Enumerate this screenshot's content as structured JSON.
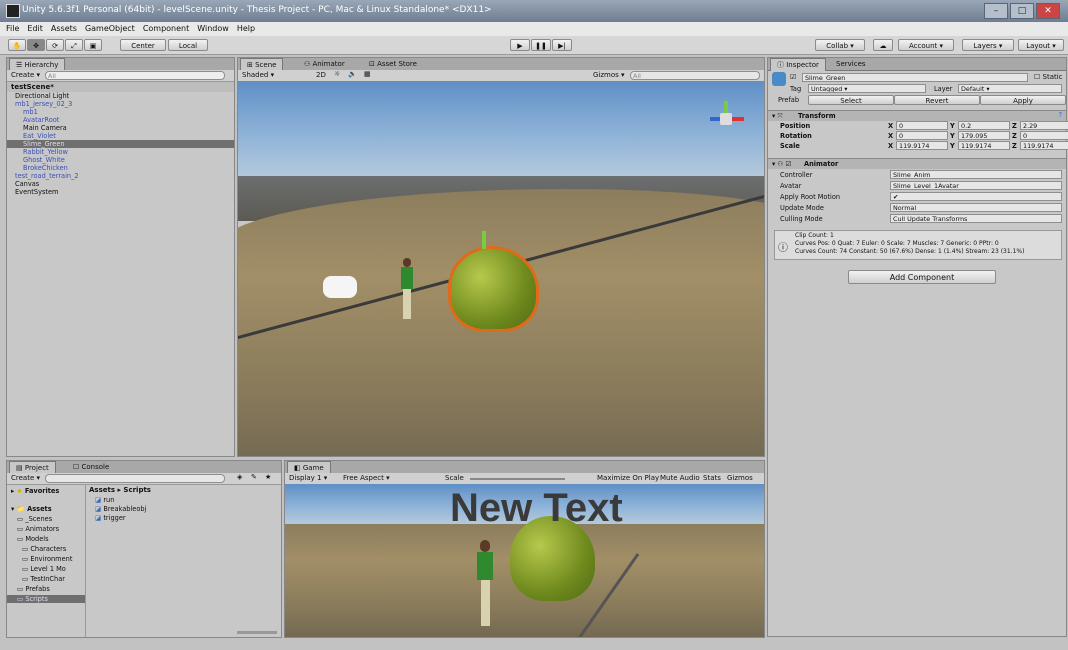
{
  "window": {
    "title": "Unity 5.6.3f1 Personal (64bit) - levelScene.unity - Thesis Project - PC, Mac & Linux Standalone* <DX11>"
  },
  "menu": [
    "File",
    "Edit",
    "Assets",
    "GameObject",
    "Component",
    "Window",
    "Help"
  ],
  "toolbar": {
    "center_label": "Center",
    "local_label": "Local",
    "collab_label": "Collab",
    "account_label": "Account",
    "layers_label": "Layers",
    "layout_label": "Layout",
    "colors": {
      "play_bg": "#d8d8d8"
    }
  },
  "hierarchy": {
    "tab": "Hierarchy",
    "create_label": "Create",
    "search_placeholder": "All",
    "scene_name": "testScene*",
    "items": [
      {
        "label": "Directional Light",
        "prefab": false,
        "indent": 1,
        "selected": false
      },
      {
        "label": "mb1_jersey_02_3",
        "prefab": true,
        "indent": 1,
        "selected": false
      },
      {
        "label": "mb1",
        "prefab": true,
        "indent": 2,
        "selected": false
      },
      {
        "label": "AvatarRoot",
        "prefab": true,
        "indent": 2,
        "selected": false
      },
      {
        "label": "Main Camera",
        "prefab": false,
        "indent": 2,
        "selected": false
      },
      {
        "label": "Eat_Violet",
        "prefab": true,
        "indent": 2,
        "selected": false
      },
      {
        "label": "Slime_Green",
        "prefab": true,
        "indent": 2,
        "selected": true
      },
      {
        "label": "Rabbit_Yellow",
        "prefab": true,
        "indent": 2,
        "selected": false
      },
      {
        "label": "Ghost_White",
        "prefab": true,
        "indent": 2,
        "selected": false
      },
      {
        "label": "BrokeChicken",
        "prefab": true,
        "indent": 2,
        "selected": false
      },
      {
        "label": "test_road_terrain_2",
        "prefab": true,
        "indent": 1,
        "selected": false
      },
      {
        "label": "Canvas",
        "prefab": false,
        "indent": 1,
        "selected": false
      },
      {
        "label": "EventSystem",
        "prefab": false,
        "indent": 1,
        "selected": false
      }
    ]
  },
  "scene": {
    "tabs": [
      "Scene",
      "Animator",
      "Asset Store"
    ],
    "shading": "Shaded",
    "mode_2d": "2D",
    "gizmos_label": "Gizmos",
    "search_placeholder": "All"
  },
  "inspector": {
    "tabs": [
      "Inspector",
      "Services"
    ],
    "object_name": "Slime_Green",
    "static_label": "Static",
    "tag_label": "Tag",
    "tag_value": "Untagged",
    "layer_label": "Layer",
    "layer_value": "Default",
    "prefab_label": "Prefab",
    "prefab_buttons": [
      "Select",
      "Revert",
      "Apply"
    ],
    "transform": {
      "title": "Transform",
      "rows": [
        {
          "label": "Position",
          "x": "0",
          "y": "0.2",
          "z": "2.29"
        },
        {
          "label": "Rotation",
          "x": "0",
          "y": "179.095",
          "z": "0"
        },
        {
          "label": "Scale",
          "x": "119.9174",
          "y": "119.9174",
          "z": "119.9174"
        }
      ]
    },
    "animator": {
      "title": "Animator",
      "rows": [
        {
          "label": "Controller",
          "value": "Slime_Anim"
        },
        {
          "label": "Avatar",
          "value": "Slime_Level_1Avatar"
        },
        {
          "label": "Apply Root Motion",
          "value": "✔"
        },
        {
          "label": "Update Mode",
          "value": "Normal"
        },
        {
          "label": "Culling Mode",
          "value": "Cull Update Transforms"
        }
      ],
      "info_line1": "Clip Count: 1",
      "info_line2": "Curves Pos: 0 Quat: 7 Euler: 0 Scale: 7 Muscles: 7 Generic: 0 PPtr: 0",
      "info_line3": "Curves Count: 74 Constant: 50 (67.6%) Dense: 1 (1.4%) Stream: 23 (31.1%)"
    },
    "add_component_label": "Add Component"
  },
  "project": {
    "tabs": [
      "Project",
      "Console"
    ],
    "create_label": "Create",
    "favorites_label": "Favorites",
    "assets_label": "Assets",
    "tree": [
      "_Scenes",
      "Animators",
      "Models",
      "Characters",
      "Environment",
      "Level 1 Mo",
      "TestInChar",
      "Prefabs",
      "Scripts"
    ],
    "breadcrumb": "Assets ▸ Scripts",
    "files": [
      "run",
      "Breakableobj",
      "trigger"
    ]
  },
  "game": {
    "tab": "Game",
    "display": "Display 1",
    "aspect": "Free Aspect",
    "scale_label": "Scale",
    "buttons": [
      "Maximize On Play",
      "Mute Audio",
      "Stats",
      "Gizmos"
    ],
    "overlay_text": "New Text"
  }
}
